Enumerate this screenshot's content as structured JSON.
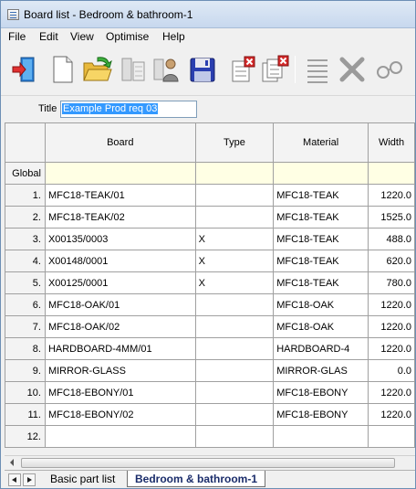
{
  "window": {
    "title": "Board list - Bedroom & bathroom-1"
  },
  "menu": [
    "File",
    "Edit",
    "View",
    "Optimise",
    "Help"
  ],
  "toolbar": {
    "icons": [
      "exit-icon",
      "new-document-icon",
      "open-folder-icon",
      "board-list-icon",
      "board-list-user-icon",
      "save-disk-icon",
      "delete-list-icon",
      "delete-lists-icon",
      "lines-icon",
      "cut-x-icon",
      "glasses-icon"
    ]
  },
  "form": {
    "title_label": "Title",
    "title_value": "Example Prod req 03"
  },
  "grid": {
    "columns": [
      "Board",
      "Type",
      "Material",
      "Width"
    ],
    "global_label": "Global",
    "rows": [
      {
        "n": "1.",
        "board": "MFC18-TEAK/01",
        "type": "",
        "material": "MFC18-TEAK",
        "width": "1220.0"
      },
      {
        "n": "2.",
        "board": "MFC18-TEAK/02",
        "type": "",
        "material": "MFC18-TEAK",
        "width": "1525.0"
      },
      {
        "n": "3.",
        "board": "X00135/0003",
        "type": "X",
        "material": "MFC18-TEAK",
        "width": "488.0"
      },
      {
        "n": "4.",
        "board": "X00148/0001",
        "type": "X",
        "material": "MFC18-TEAK",
        "width": "620.0"
      },
      {
        "n": "5.",
        "board": "X00125/0001",
        "type": "X",
        "material": "MFC18-TEAK",
        "width": "780.0"
      },
      {
        "n": "6.",
        "board": "MFC18-OAK/01",
        "type": "",
        "material": "MFC18-OAK",
        "width": "1220.0"
      },
      {
        "n": "7.",
        "board": "MFC18-OAK/02",
        "type": "",
        "material": "MFC18-OAK",
        "width": "1220.0"
      },
      {
        "n": "8.",
        "board": "HARDBOARD-4MM/01",
        "type": "",
        "material": "HARDBOARD-4",
        "width": "1220.0"
      },
      {
        "n": "9.",
        "board": "MIRROR-GLASS",
        "type": "",
        "material": "MIRROR-GLAS",
        "width": "0.0"
      },
      {
        "n": "10.",
        "board": "MFC18-EBONY/01",
        "type": "",
        "material": "MFC18-EBONY",
        "width": "1220.0"
      },
      {
        "n": "11.",
        "board": "MFC18-EBONY/02",
        "type": "",
        "material": "MFC18-EBONY",
        "width": "1220.0"
      },
      {
        "n": "12.",
        "board": "",
        "type": "",
        "material": "",
        "width": ""
      }
    ]
  },
  "tabs": {
    "inactive": "Basic part list",
    "active": "Bedroom & bathroom-1"
  }
}
